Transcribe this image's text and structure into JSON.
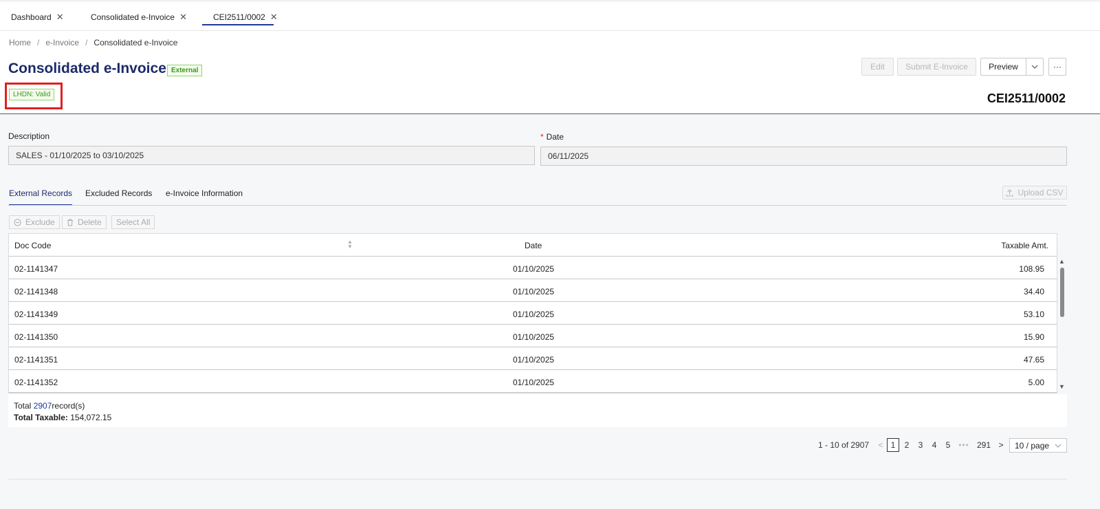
{
  "tabs": [
    {
      "label": "Dashboard"
    },
    {
      "label": "Consolidated e-Invoice"
    },
    {
      "label": "CEI2511/0002"
    }
  ],
  "tab_close_glyph": "✕",
  "breadcrumb": {
    "items": [
      "Home",
      "e-Invoice",
      "Consolidated e-Invoice"
    ],
    "separator": "/"
  },
  "header": {
    "title": "Consolidated e-Invoice",
    "type_tag": "External",
    "status_tag": "LHDN: Valid",
    "doc_number": "CEI2511/0002",
    "actions": {
      "edit": "Edit",
      "submit": "Submit E-Invoice",
      "preview": "Preview",
      "more": "···"
    }
  },
  "form": {
    "description_label": "Description",
    "description_value": "SALES - 01/10/2025 to 03/10/2025",
    "date_required_mark": "*",
    "date_label": "Date",
    "date_value": "06/11/2025"
  },
  "subtabs": [
    "External Records",
    "Excluded Records",
    "e-Invoice Information"
  ],
  "upload_csv": "Upload CSV",
  "table_actions": {
    "exclude": "Exclude",
    "delete": "Delete",
    "select_all": "Select All"
  },
  "table": {
    "columns": [
      "Doc Code",
      "Date",
      "Taxable Amt."
    ],
    "rows": [
      {
        "doc_code": "02-1141347",
        "date": "01/10/2025",
        "taxable": "108.95"
      },
      {
        "doc_code": "02-1141348",
        "date": "01/10/2025",
        "taxable": "34.40"
      },
      {
        "doc_code": "02-1141349",
        "date": "01/10/2025",
        "taxable": "53.10"
      },
      {
        "doc_code": "02-1141350",
        "date": "01/10/2025",
        "taxable": "15.90"
      },
      {
        "doc_code": "02-1141351",
        "date": "01/10/2025",
        "taxable": "47.65"
      },
      {
        "doc_code": "02-1141352",
        "date": "01/10/2025",
        "taxable": "5.00"
      }
    ]
  },
  "summary": {
    "total_prefix": "Total",
    "total_count": "2907",
    "total_suffix": "record(s)",
    "taxable_label": "Total Taxable:",
    "taxable_value": "154,072.15"
  },
  "pagination": {
    "range_text": "1 - 10 of 2907",
    "prev": "<",
    "pages": [
      "1",
      "2",
      "3",
      "4",
      "5"
    ],
    "dots": "•••",
    "last_page": "291",
    "next": ">",
    "page_size": "10 / page"
  },
  "colors": {
    "accent": "#1f3a93",
    "title": "#1c2a6b",
    "tag_green": "#3a9a1b",
    "highlight_red": "#e0201f"
  }
}
